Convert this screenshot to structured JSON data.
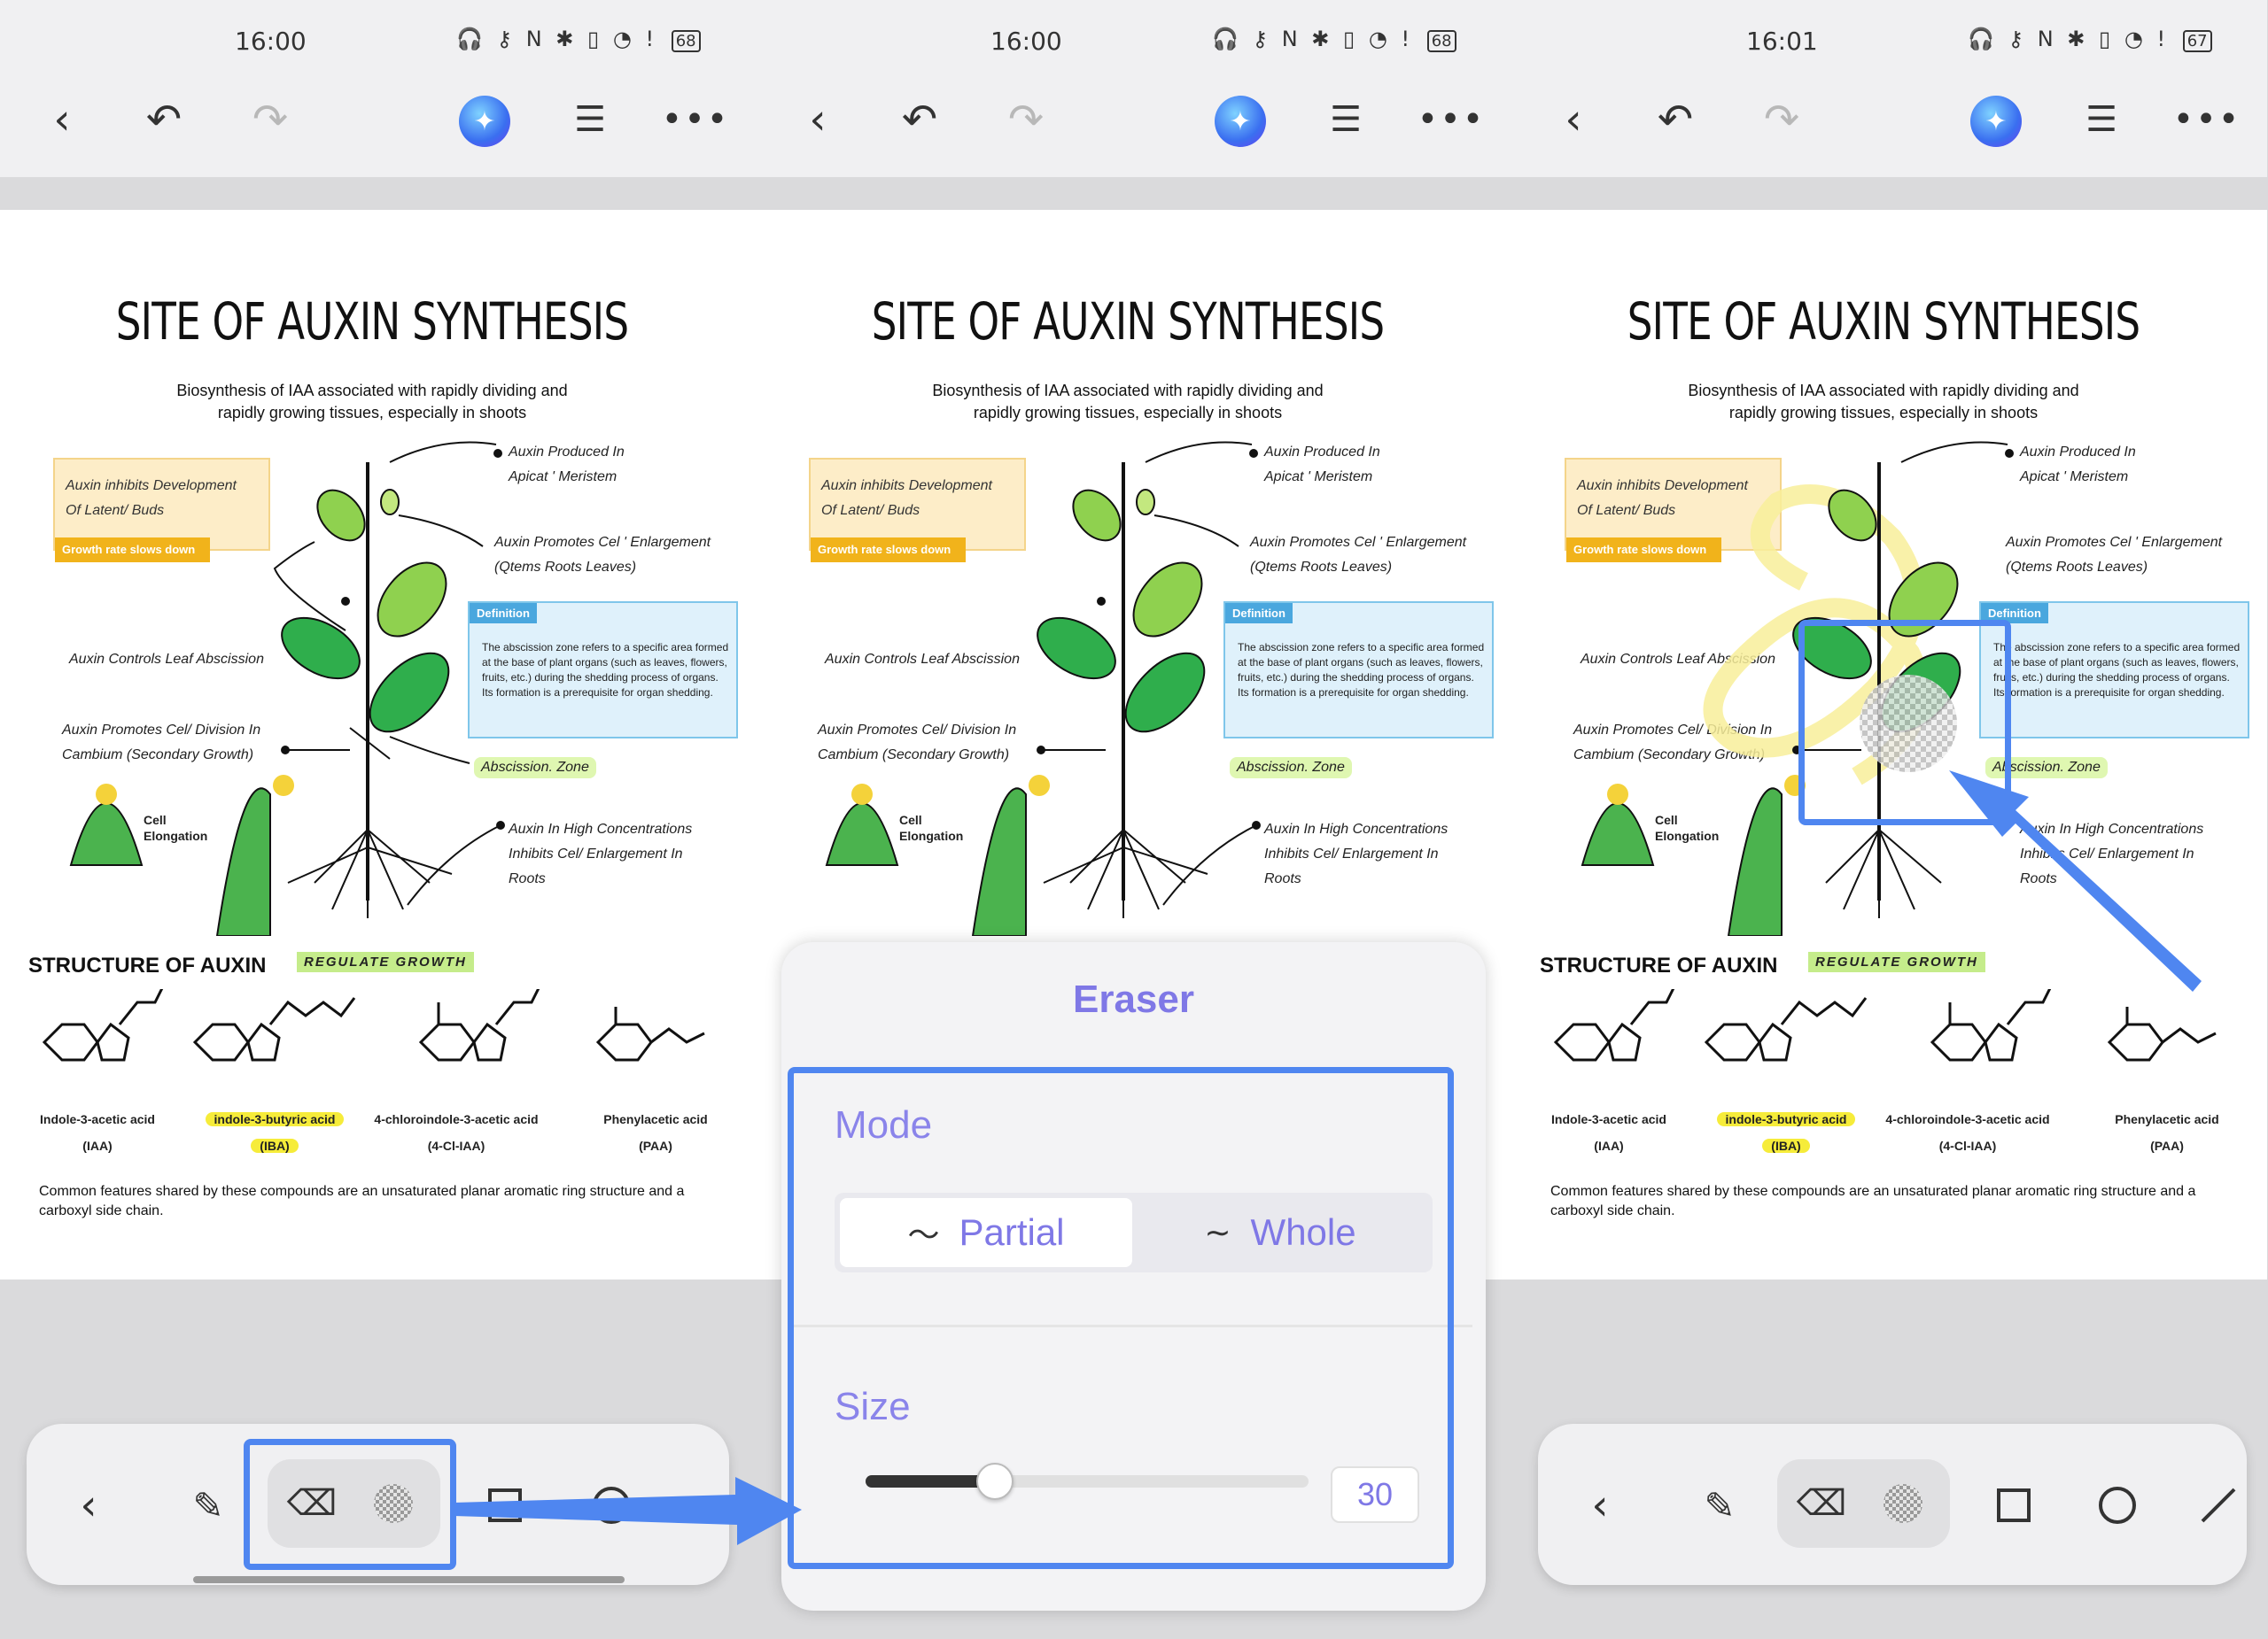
{
  "panels": [
    {
      "time": "16:00",
      "battery": "68"
    },
    {
      "time": "16:00",
      "battery": "68"
    },
    {
      "time": "16:01",
      "battery": "67"
    }
  ],
  "doc": {
    "title": "SITE OF AUXIN SYNTHESIS",
    "subtitle_line1": "Biosynthesis of IAA associated with rapidly dividing and",
    "subtitle_line2": "rapidly growing tissues, especially in shoots",
    "note_line1": "Auxin inhibits Development",
    "note_line2": "Of Latent/ Buds",
    "note_tag": "Growth rate slows down",
    "label_apical_1": "Auxin Produced In",
    "label_apical_2": "Apicat ' Meristem",
    "label_enlarge_1": "Auxin Promotes Cel ' Enlargement",
    "label_enlarge_2": "(Qtems Roots Leaves)",
    "def_tag": "Definition",
    "def_text": "The abscission zone refers to a specific area formed at the base of plant organs (such as leaves, flowers, fruits, etc.) during the shedding process of organs. Its formation is a prerequisite for organ shedding.",
    "label_abscission": "Auxin Controls Leaf Abscission",
    "label_division_1": "Auxin Promotes Cel/ Division In",
    "label_division_2": "Cambium (Secondary Growth)",
    "abscission_zone": "Abscission. Zone",
    "cell_line1": "Cell",
    "cell_line2": "Elongation",
    "label_high_1": "Auxin In High Concentrations",
    "label_high_2": "Inhibits Cel/ Enlargement In",
    "label_high_3": "Roots",
    "structure_title": "STRUCTURE OF AUXIN",
    "regulate": "REGULATE GROWTH",
    "molecules": [
      {
        "name": "Indole-3-acetic acid",
        "abbr": "(IAA)"
      },
      {
        "name": "indole-3-butyric acid",
        "abbr": "(IBA)"
      },
      {
        "name": "4-chloroindole-3-acetic acid",
        "abbr": "(4-Cl-IAA)"
      },
      {
        "name": "Phenylacetic acid",
        "abbr": "(PAA)"
      }
    ],
    "common_text": "Common features shared by these compounds are an unsaturated planar aromatic ring structure and a carboxyl side chain."
  },
  "eraser": {
    "title": "Eraser",
    "mode_label": "Mode",
    "mode_partial": "Partial",
    "mode_whole": "Whole",
    "mode_selected": "Partial",
    "size_label": "Size",
    "size_value": "30",
    "size_min": 1,
    "size_max": 100
  },
  "icons": {
    "back": "chevron-left-icon",
    "undo": "undo-icon",
    "redo": "redo-icon",
    "ai": "ai-assistant-icon",
    "outline": "list-icon",
    "more": "more-icon",
    "pen": "pen-icon",
    "eraser": "eraser-icon",
    "eraser_texture": "checker-eraser-icon",
    "rectangle": "square-icon",
    "circle": "circle-icon",
    "line": "line-icon"
  },
  "colors": {
    "accent": "#4f86f0",
    "eraser_text": "#7f78e6",
    "note_tag": "#f1b31b",
    "definition": "#4aa7de",
    "highlight_yellow": "#f6ec3a",
    "highlight_green": "#c5ec8b"
  }
}
